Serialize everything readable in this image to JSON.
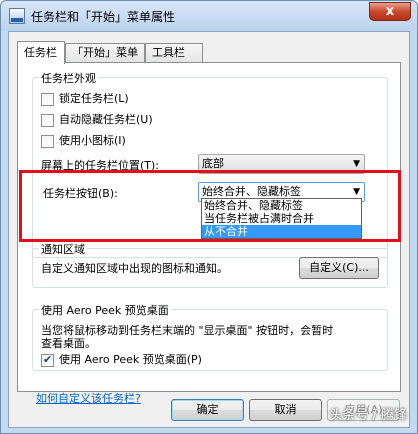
{
  "window": {
    "title": "任务栏和「开始」菜单属性",
    "close_label": "x"
  },
  "tabs": [
    {
      "label": "任务栏"
    },
    {
      "label": "「开始」菜单"
    },
    {
      "label": "工具栏"
    }
  ],
  "appearance": {
    "legend": "任务栏外观",
    "lock_label": "锁定任务栏(L)",
    "autohide_label": "自动隐藏任务栏(U)",
    "small_icons_label": "使用小图标(I)",
    "location_label": "屏幕上的任务栏位置(T):",
    "location_value": "底部",
    "buttons_label": "任务栏按钮(B):",
    "buttons_value": "始终合并、隐藏标签",
    "buttons_options": [
      "始终合并、隐藏标签",
      "当任务栏被占满时合并",
      "从不合并"
    ]
  },
  "notify": {
    "legend": "通知区域",
    "desc": "自定义通知区域中出现的图标和通知。",
    "customize_button": "自定义(C)..."
  },
  "aero": {
    "legend": "使用 Aero Peek 预览桌面",
    "desc_line1": "当您将鼠标移动到任务栏末端的 \"显示桌面\" 按钮时，会暂时",
    "desc_line2": "查看桌面。",
    "checkbox_label": "使用 Aero Peek 预览桌面(P)"
  },
  "link": "如何自定义该任务栏?",
  "buttons": {
    "ok": "确定",
    "cancel": "取消",
    "apply": "应用(A)"
  },
  "watermark": "头条号 / 腾锋",
  "colors": {
    "highlight": "#e0101a",
    "selection": "#3399ff"
  }
}
